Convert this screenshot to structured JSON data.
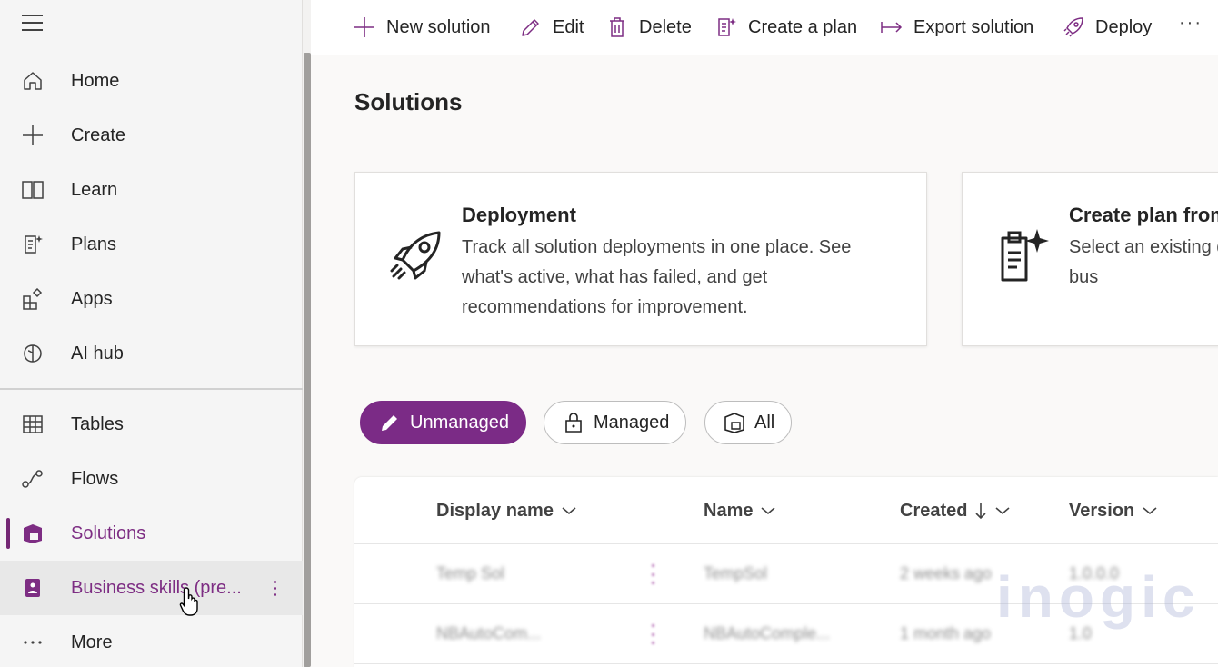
{
  "sidebar": {
    "items": [
      {
        "label": "Home",
        "icon": "home-icon"
      },
      {
        "label": "Create",
        "icon": "plus-icon"
      },
      {
        "label": "Learn",
        "icon": "book-icon"
      },
      {
        "label": "Plans",
        "icon": "plan-icon"
      },
      {
        "label": "Apps",
        "icon": "apps-icon"
      },
      {
        "label": "AI hub",
        "icon": "brain-icon"
      },
      {
        "label": "Tables",
        "icon": "table-icon"
      },
      {
        "label": "Flows",
        "icon": "flow-icon"
      },
      {
        "label": "Solutions",
        "icon": "solutions-icon"
      },
      {
        "label": "Business skills (pre...",
        "icon": "business-skills-icon"
      },
      {
        "label": "More",
        "icon": "more-icon"
      }
    ],
    "selected": "Solutions"
  },
  "toolbar": {
    "new_solution": "New solution",
    "edit": "Edit",
    "delete": "Delete",
    "create_plan": "Create a plan",
    "export": "Export solution",
    "deploy": "Deploy",
    "more": "···"
  },
  "page": {
    "title": "Solutions"
  },
  "cards": [
    {
      "title": "Deployment",
      "desc": "Track all solution deployments in one place. See what's active, what has failed, and get recommendations for improvement.",
      "icon": "rocket-icon"
    },
    {
      "title": "Create plan from",
      "desc": "Select an existing generate a detaile supports your bus",
      "icon": "plan-sparkle-icon"
    }
  ],
  "filters": [
    {
      "label": "Unmanaged",
      "active": true
    },
    {
      "label": "Managed",
      "active": false
    },
    {
      "label": "All",
      "active": false
    }
  ],
  "grid": {
    "columns": [
      "Display name",
      "Name",
      "Created",
      "Version"
    ],
    "rows": [
      [
        "Temp Sol",
        "TempSol",
        "2 weeks ago",
        "1.0.0.0"
      ],
      [
        "NBAutoCom...",
        "NBAutoComple...",
        "1 month ago",
        "1.0"
      ]
    ]
  },
  "watermark": "inogic",
  "colors": {
    "accent": "#742774",
    "pill_active": "#7b2b86"
  }
}
